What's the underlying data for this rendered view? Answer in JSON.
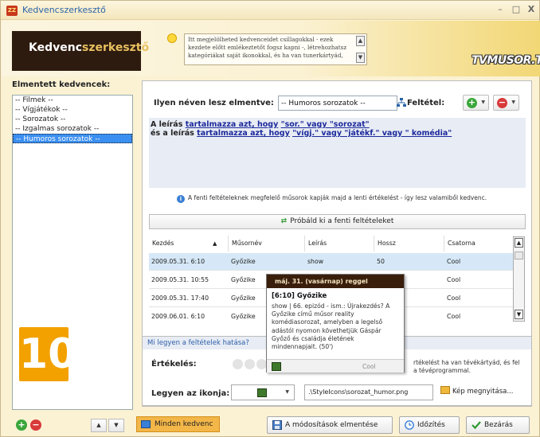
{
  "window": {
    "title": "Kedvencszerkesztő",
    "app_icon_text": "ZZ",
    "minimize": "–",
    "maximize": "□",
    "close": "X"
  },
  "header": {
    "brand_part1": "Kedvenc",
    "brand_part2": "szerkesztő",
    "hint_text": "Itt megjelölheted kedvenceidet csillagokkal - ezek kezdete előtt emlékeztetőt fogsz kapni -, létrehozhatsz kategóriákat saját ikonokkal, és ha van tunerkártyád,",
    "logo_text": "TVMUSOR.TV"
  },
  "sidebar": {
    "title": "Elmentett kedvencek:",
    "items": [
      {
        "label": "-- Filmek --"
      },
      {
        "label": "-- Vígjátékok --"
      },
      {
        "label": "-- Sorozatok --"
      },
      {
        "label": "-- Izgalmas sorozatok --"
      },
      {
        "label": "-- Humoros sorozatok --",
        "selected": true
      }
    ],
    "big_number": "10",
    "add_symbol": "+",
    "remove_symbol": "−",
    "up_symbol": "▲",
    "down_symbol": "▼"
  },
  "editor": {
    "name_label": "Ilyen néven lesz elmentve:",
    "name_value": "-- Humoros sorozatok --",
    "condition_label": "Feltétel:",
    "add_condition": "+",
    "remove_condition": "−",
    "dropdown_arrow": "▼",
    "rule1_prefix": "A leírás",
    "rule1_op": "tartalmazza azt, hogy",
    "rule1_values": "\"sor.\" vagy \"sorozat\"",
    "rule2_prefix": "és a leírás",
    "rule2_op": "tartalmazza azt, hogy",
    "rule2_values": "\"vígj.\" vagy \"játékf.\" vagy \" komédia\"",
    "info_text": "A fenti feltételeknek megfelelő műsorok kapják majd a lenti értékelést - így lesz valamiből kedvenc.",
    "try_button": "Próbáld ki a fenti feltételeket"
  },
  "grid": {
    "columns": [
      "Kezdés",
      "Műsornév",
      "Leírás",
      "Hossz",
      "Csatorna"
    ],
    "sort_indicator": "▲",
    "rows": [
      {
        "start": "2009.05.31. 6:10",
        "name": "Győzike",
        "desc": "show",
        "length": "50",
        "channel": "Cool",
        "selected": true
      },
      {
        "start": "2009.05.31. 10:55",
        "name": "Győzike",
        "desc": "",
        "length": "",
        "channel": "Cool"
      },
      {
        "start": "2009.05.31. 17:40",
        "name": "Győzike",
        "desc": "",
        "length": "",
        "channel": "Cool"
      },
      {
        "start": "2009.06.01. 6:10",
        "name": "Győzike",
        "desc": "",
        "length": "",
        "channel": "Cool"
      }
    ],
    "scroll_up": "▲",
    "scroll_down": "▼"
  },
  "tooltip": {
    "header": "máj. 31. (vasárnap) reggel",
    "title": "[6:10] Győzike",
    "body": "show | 66. epizód - ism.: Újrakezdés? A Győzike című műsor reality komédiasorozat, amelyben a legelső adástól nyomon követhetjük Gáspár Győző és családja életének mindennapjait. (50')",
    "channel": "Cool"
  },
  "effect": {
    "header": "Mi legyen a feltételek hatása?",
    "eval_label": "Értékelés:",
    "eval_note_line1": "rtékelést ha van tévékártyád, és fel",
    "eval_note_line2": "a tévéprogrammal.",
    "icon_label": "Legyen az ikonja:",
    "icon_path": ".\\StyleIcons\\sorozat_humor.png",
    "open_image": "Kép megnyitása..."
  },
  "bottom": {
    "all_favorites": "Minden kedvenc",
    "save_changes": "A módosítások elmentése",
    "timing": "Időzítés",
    "close": "Bezárás"
  },
  "colors": {
    "accent_blue": "#2a63a8",
    "selection": "#3b8ff0",
    "brand_dark": "#2e1b0f",
    "orange": "#f2a100"
  }
}
